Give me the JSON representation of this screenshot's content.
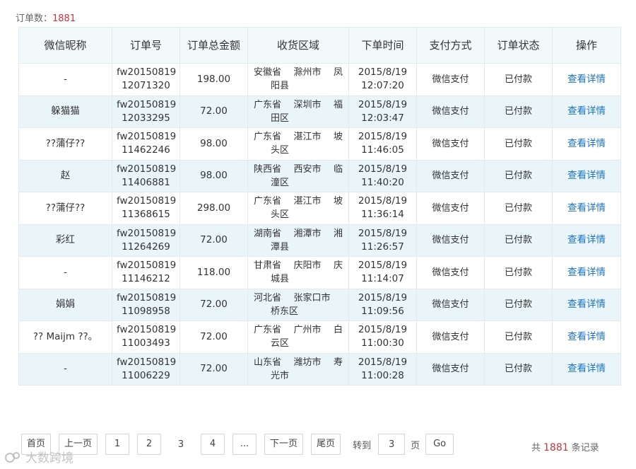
{
  "header": {
    "count_label": "订单数：",
    "count_value": "1881"
  },
  "table": {
    "columns": [
      "微信昵称",
      "订单号",
      "订单总金额",
      "收货区域",
      "下单时间",
      "支付方式",
      "订单状态",
      "操作"
    ],
    "rows": [
      {
        "nickname": "-",
        "order_no_1": "fw20150819",
        "order_no_2": "12071320",
        "amount": "198.00",
        "prov": "安徽省",
        "city": "滁州市",
        "dist_1": "凤",
        "dist_2": "阳县",
        "date": "2015/8/19",
        "time": "12:07:20",
        "pay": "微信支付",
        "status": "已付款",
        "action": "查看详情"
      },
      {
        "nickname": "躲猫猫",
        "order_no_1": "fw20150819",
        "order_no_2": "12033295",
        "amount": "72.00",
        "prov": "广东省",
        "city": "深圳市",
        "dist_1": "福",
        "dist_2": "田区",
        "date": "2015/8/19",
        "time": "12:03:47",
        "pay": "微信支付",
        "status": "已付款",
        "action": "查看详情"
      },
      {
        "nickname": "??蒲仔??",
        "order_no_1": "fw20150819",
        "order_no_2": "11462246",
        "amount": "98.00",
        "prov": "广东省",
        "city": "湛江市",
        "dist_1": "坡",
        "dist_2": "头区",
        "date": "2015/8/19",
        "time": "11:46:05",
        "pay": "微信支付",
        "status": "已付款",
        "action": "查看详情"
      },
      {
        "nickname": "赵",
        "order_no_1": "fw20150819",
        "order_no_2": "11406881",
        "amount": "98.00",
        "prov": "陕西省",
        "city": "西安市",
        "dist_1": "临",
        "dist_2": "潼区",
        "date": "2015/8/19",
        "time": "11:40:20",
        "pay": "微信支付",
        "status": "已付款",
        "action": "查看详情"
      },
      {
        "nickname": "??蒲仔??",
        "order_no_1": "fw20150819",
        "order_no_2": "11368615",
        "amount": "298.00",
        "prov": "广东省",
        "city": "湛江市",
        "dist_1": "坡",
        "dist_2": "头区",
        "date": "2015/8/19",
        "time": "11:36:14",
        "pay": "微信支付",
        "status": "已付款",
        "action": "查看详情"
      },
      {
        "nickname": "彩红",
        "order_no_1": "fw20150819",
        "order_no_2": "11264269",
        "amount": "72.00",
        "prov": "湖南省",
        "city": "湘潭市",
        "dist_1": "湘",
        "dist_2": "潭县",
        "date": "2015/8/19",
        "time": "11:26:57",
        "pay": "微信支付",
        "status": "已付款",
        "action": "查看详情"
      },
      {
        "nickname": "-",
        "order_no_1": "fw20150819",
        "order_no_2": "11146212",
        "amount": "118.00",
        "prov": "甘肃省",
        "city": "庆阳市",
        "dist_1": "庆",
        "dist_2": "城县",
        "date": "2015/8/19",
        "time": "11:14:07",
        "pay": "微信支付",
        "status": "已付款",
        "action": "查看详情"
      },
      {
        "nickname": "娟娟",
        "order_no_1": "fw20150819",
        "order_no_2": "11098958",
        "amount": "72.00",
        "prov": "河北省",
        "city": "张家口市",
        "dist_1": "",
        "dist_2": "桥东区",
        "date": "2015/8/19",
        "time": "11:09:56",
        "pay": "微信支付",
        "status": "已付款",
        "action": "查看详情"
      },
      {
        "nickname": "?? Maijm ??。",
        "order_no_1": "fw20150819",
        "order_no_2": "11003493",
        "amount": "72.00",
        "prov": "广东省",
        "city": "广州市",
        "dist_1": "白",
        "dist_2": "云区",
        "date": "2015/8/19",
        "time": "11:00:30",
        "pay": "微信支付",
        "status": "已付款",
        "action": "查看详情"
      },
      {
        "nickname": "-",
        "order_no_1": "fw20150819",
        "order_no_2": "11006229",
        "amount": "72.00",
        "prov": "山东省",
        "city": "潍坊市",
        "dist_1": "寿",
        "dist_2": "光市",
        "date": "2015/8/19",
        "time": "11:00:28",
        "pay": "微信支付",
        "status": "已付款",
        "action": "查看详情"
      }
    ]
  },
  "pager": {
    "first": "首页",
    "prev": "上一页",
    "pages": [
      "1",
      "2"
    ],
    "current": "3",
    "next_pages": [
      "4"
    ],
    "ellipsis": "...",
    "next": "下一页",
    "last": "尾页",
    "jump_label": "转到",
    "jump_value": "3",
    "page_unit": "页",
    "go": "Go"
  },
  "total": {
    "prefix": "共",
    "count": "1881",
    "suffix": "条记录"
  },
  "watermark": {
    "text": "大数跨境"
  }
}
